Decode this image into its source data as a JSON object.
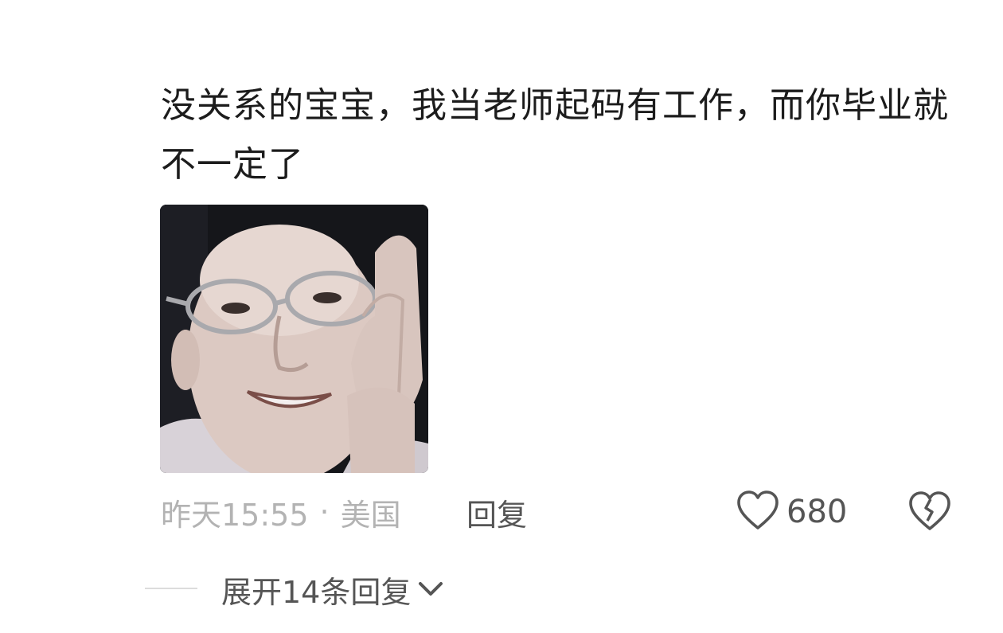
{
  "comment": {
    "text": "没关系的宝宝，我当老师起码有工作，而你毕业就不一定了",
    "image": "meme-photo-man-with-glasses-gesturing"
  },
  "meta": {
    "time": "昨天15:55",
    "separator": "·",
    "location": "美国"
  },
  "actions": {
    "reply_label": "回复",
    "like_icon": "heart-outline-icon",
    "like_count": "680",
    "dislike_icon": "broken-heart-icon"
  },
  "replies": {
    "expand_label": "展开14条回复",
    "expand_icon": "chevron-down-icon"
  },
  "colors": {
    "text_primary": "#1c1c1c",
    "text_meta": "#b3b3b3",
    "text_action": "#555555"
  }
}
